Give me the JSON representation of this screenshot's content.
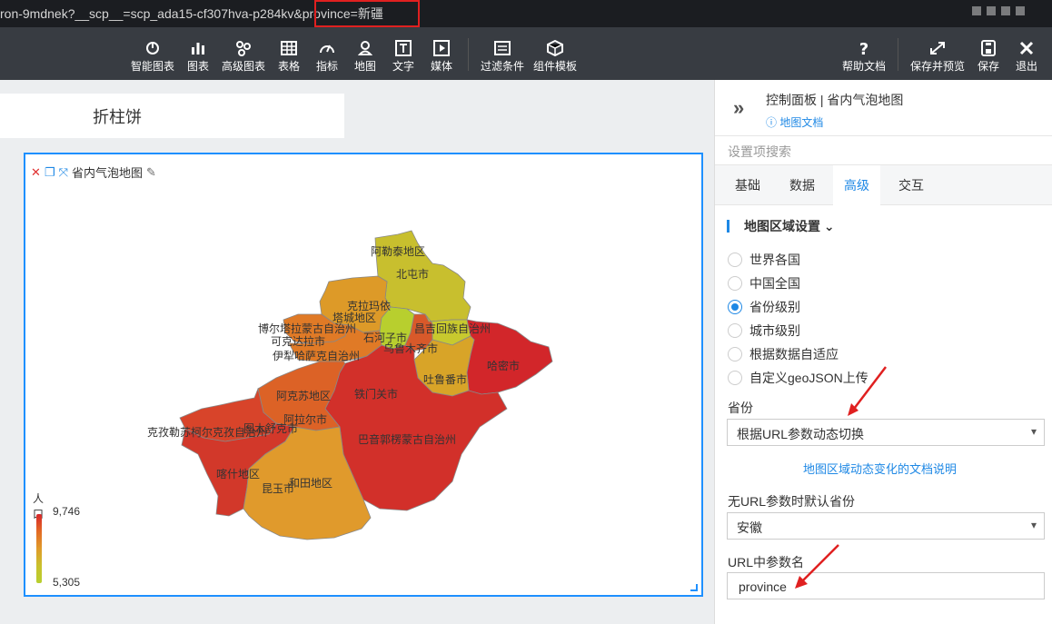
{
  "url": {
    "text": "ron-9mdnek?__scp__=scp_ada15-cf307hva-p284kv&province=新疆"
  },
  "toolbar": {
    "items": [
      {
        "label": "智能图表",
        "icon": "smart-chart-icon"
      },
      {
        "label": "图表",
        "icon": "bar-chart-icon"
      },
      {
        "label": "高级图表",
        "icon": "advanced-chart-icon"
      },
      {
        "label": "表格",
        "icon": "table-icon"
      },
      {
        "label": "指标",
        "icon": "gauge-icon"
      },
      {
        "label": "地图",
        "icon": "map-pin-icon"
      },
      {
        "label": "文字",
        "icon": "text-icon"
      },
      {
        "label": "媒体",
        "icon": "media-icon"
      },
      {
        "label": "过滤条件",
        "icon": "filter-icon"
      },
      {
        "label": "组件模板",
        "icon": "template-icon"
      },
      {
        "label": "帮助文档",
        "icon": "help-icon"
      },
      {
        "label": "保存并预览",
        "icon": "expand-icon"
      },
      {
        "label": "保存",
        "icon": "save-icon"
      },
      {
        "label": "退出",
        "icon": "close-icon"
      }
    ]
  },
  "canvas": {
    "title_card": "折柱饼",
    "map_card": {
      "title": "省内气泡地图",
      "legend": {
        "title": "人口",
        "max": "9,746",
        "min": "5,305"
      },
      "regions": [
        {
          "name": "阿勒泰地区",
          "color": "#c8bf2e"
        },
        {
          "name": "北屯市",
          "color": "#c8bf2e"
        },
        {
          "name": "克拉玛依",
          "color": "#dd9a28"
        },
        {
          "name": "塔城地区",
          "color": "#dd9a28"
        },
        {
          "name": "博尔塔拉蒙古自治州",
          "color": "#e07a26"
        },
        {
          "name": "可克达拉市",
          "color": "#e07a26"
        },
        {
          "name": "伊犁哈萨克自治州",
          "color": "#e07a26"
        },
        {
          "name": "石河子市",
          "color": "#b8cf2e"
        },
        {
          "name": "昌吉回族自治州",
          "color": "#c8c92e"
        },
        {
          "name": "乌鲁木齐市",
          "color": "#d8592a"
        },
        {
          "name": "哈密市",
          "color": "#d2262a"
        },
        {
          "name": "吐鲁番市",
          "color": "#d8a428"
        },
        {
          "name": "铁门关市",
          "color": "#d2362a"
        },
        {
          "name": "阿克苏地区",
          "color": "#dc6226"
        },
        {
          "name": "阿拉尔市",
          "color": "#dc6226"
        },
        {
          "name": "巴音郭楞蒙古自治州",
          "color": "#d2302a"
        },
        {
          "name": "克孜勒苏柯尔克孜自治州",
          "color": "#d8442a"
        },
        {
          "name": "图木舒克市",
          "color": "#d8442a"
        },
        {
          "name": "喀什地区",
          "color": "#d2382a"
        },
        {
          "name": "和田地区",
          "color": "#e09a2c"
        },
        {
          "name": "昆玉市",
          "color": "#e09a2c"
        }
      ]
    }
  },
  "panel": {
    "title": "控制面板 | 省内气泡地图",
    "doc_link": "地图文档",
    "search_placeholder": "设置项搜索",
    "tabs": [
      "基础",
      "数据",
      "高级",
      "交互"
    ],
    "active_tab": "高级",
    "section_title": "地图区域设置",
    "radios": [
      "世界各国",
      "中国全国",
      "省份级别",
      "城市级别",
      "根据数据自适应",
      "自定义geoJSON上传"
    ],
    "checked_radio": "省份级别",
    "province_label": "省份",
    "province_value": "根据URL参数动态切换",
    "dynamic_doc": "地图区域动态变化的文档说明",
    "default_label": "无URL参数时默认省份",
    "default_value": "安徽",
    "param_label": "URL中参数名",
    "param_value": "province"
  },
  "colors": {
    "accent": "#1e88e5",
    "highlight_box": "#e02020",
    "toolbar_bg": "#383c42"
  }
}
